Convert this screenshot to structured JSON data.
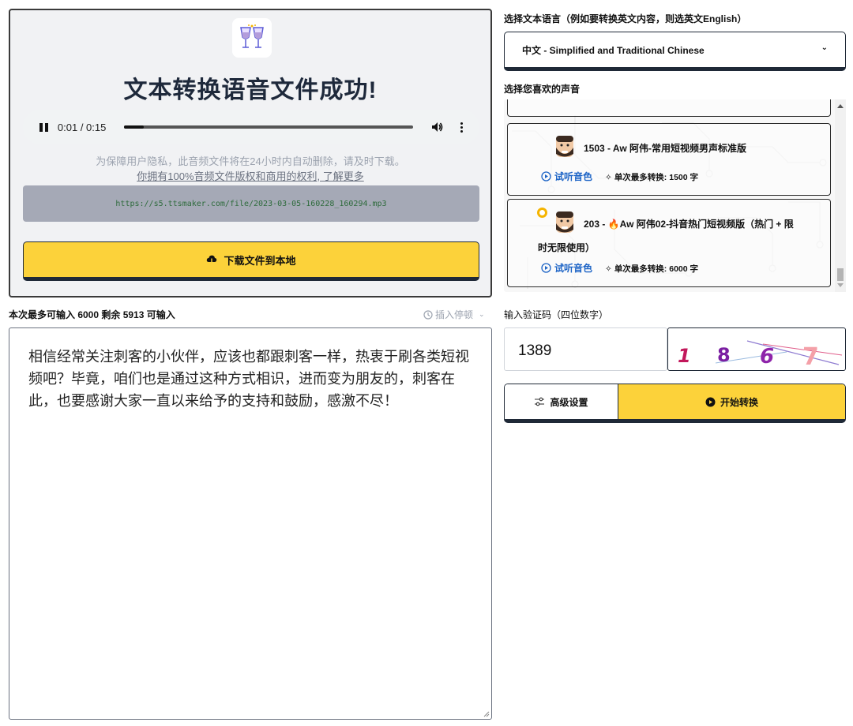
{
  "result": {
    "title": "文本转换语音文件成功!",
    "audio": {
      "time": "0:01 / 0:15",
      "progress": 0.07
    },
    "privacy_note": "为保障用户隐私，此音频文件将在24小时内自动删除，请及时下载。",
    "rights_link": "你拥有100%音频文件版权和商用的权利, 了解更多",
    "file_url": "https://s5.ttsmaker.com/file/2023-03-05-160228_160294.mp3",
    "download_label": "下载文件到本地"
  },
  "editor": {
    "limit_text": "本次最多可输入 6000 剩余 5913 可输入",
    "insert_pause": "插入停顿",
    "content": "相信经常关注刺客的小伙伴，应该也都跟刺客一样，热衷于刷各类短视频吧？毕竟，咱们也是通过这种方式相识，进而变为朋友的，刺客在此，也要感谢大家一直以来给予的支持和鼓励，感激不尽！"
  },
  "language": {
    "label": "选择文本语言（例如要转换英文内容，则选英文English）",
    "selected": "中文 - Simplified and Traditional Chinese"
  },
  "voices": {
    "label": "选择您喜欢的声音",
    "items": [
      {
        "name": "1503 - Aw 阿伟-常用短视频男声标准版",
        "try_label": "试听音色",
        "max_label": "单次最多转换: 1500 字",
        "selected": false
      },
      {
        "name_line1": "203 - 🔥Aw 阿伟02-抖音热门短视频版（热门 + 限",
        "name_line2": "时无限使用）",
        "try_label": "试听音色",
        "max_label": "单次最多转换: 6000 字",
        "selected": true
      }
    ]
  },
  "captcha": {
    "label": "输入验证码（四位数字）",
    "value": "1389",
    "image_chars": [
      "1",
      "8",
      "6",
      "7"
    ]
  },
  "actions": {
    "advanced_label": "高级设置",
    "start_label": "开始转换"
  },
  "colors": {
    "accent_yellow": "#fcd23a",
    "link_blue": "#1d64c6",
    "border_dark": "#1f2937",
    "radio_orange": "#f5b400"
  }
}
